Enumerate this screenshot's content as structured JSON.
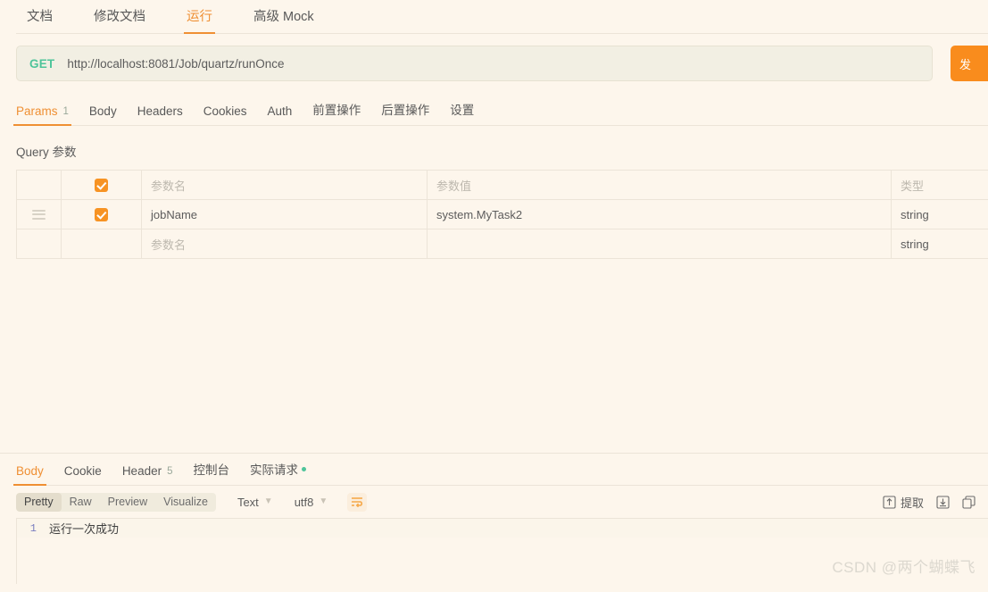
{
  "top_tabs": [
    {
      "label": "文档",
      "active": false
    },
    {
      "label": "修改文档",
      "active": false
    },
    {
      "label": "运行",
      "active": true
    },
    {
      "label": "高级 Mock",
      "active": false
    }
  ],
  "request": {
    "method": "GET",
    "url": "http://localhost:8081/Job/quartz/runOnce",
    "send_label": "发"
  },
  "sub_tabs": [
    {
      "label": "Params",
      "badge": "1",
      "active": true
    },
    {
      "label": "Body",
      "badge": "",
      "active": false
    },
    {
      "label": "Headers",
      "badge": "",
      "active": false
    },
    {
      "label": "Cookies",
      "badge": "",
      "active": false
    },
    {
      "label": "Auth",
      "badge": "",
      "active": false
    },
    {
      "label": "前置操作",
      "badge": "",
      "active": false
    },
    {
      "label": "后置操作",
      "badge": "",
      "active": false
    },
    {
      "label": "设置",
      "badge": "",
      "active": false
    }
  ],
  "params": {
    "section_title": "Query 参数",
    "headers": {
      "name": "参数名",
      "value": "参数值",
      "type": "类型"
    },
    "rows": [
      {
        "checked": true,
        "name": "jobName",
        "name_placeholder": "",
        "value": "system.MyTask2",
        "type": "string",
        "has_drag": true
      },
      {
        "checked": false,
        "name": "",
        "name_placeholder": "参数名",
        "value": "",
        "type": "string",
        "has_drag": false
      }
    ]
  },
  "response": {
    "tabs": [
      {
        "label": "Body",
        "badge": "",
        "dot": false,
        "active": true
      },
      {
        "label": "Cookie",
        "badge": "",
        "dot": false,
        "active": false
      },
      {
        "label": "Header",
        "badge": "5",
        "dot": false,
        "active": false
      },
      {
        "label": "控制台",
        "badge": "",
        "dot": false,
        "active": false
      },
      {
        "label": "实际请求",
        "badge": "",
        "dot": true,
        "active": false
      }
    ],
    "view_modes": [
      {
        "label": "Pretty",
        "active": true
      },
      {
        "label": "Raw",
        "active": false
      },
      {
        "label": "Preview",
        "active": false
      },
      {
        "label": "Visualize",
        "active": false
      }
    ],
    "format_select": "Text",
    "encoding_select": "utf8",
    "extract_label": "提取",
    "body_lines": [
      {
        "number": "1",
        "text": "运行一次成功"
      }
    ]
  },
  "watermark": "CSDN @两个蝴蝶飞",
  "colors": {
    "accent": "#ef8f33",
    "method_get": "#4ec49a",
    "checkbox": "#f79323",
    "page_bg": "#fdf6ec"
  }
}
